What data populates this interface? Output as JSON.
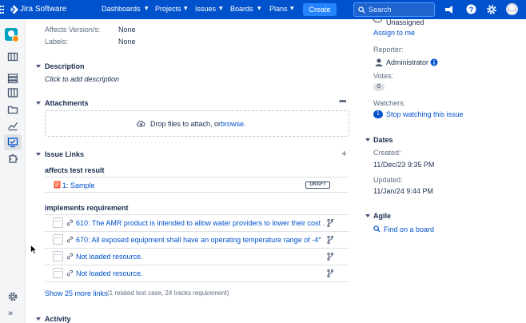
{
  "topnav": {
    "brand": "Jira Software",
    "menus": [
      "Dashboards",
      "Projects",
      "Issues",
      "Boards",
      "Plans"
    ],
    "create_label": "Create",
    "search_placeholder": "Search"
  },
  "fields": {
    "affects_versions_label": "Affects Version/s:",
    "affects_versions_value": "None",
    "labels_label": "Labels:",
    "labels_value": "None"
  },
  "description": {
    "title": "Description",
    "placeholder": "Click to add description"
  },
  "attachments": {
    "title": "Attachments",
    "drop_text": "Drop files to attach, or",
    "browse_link": "browse."
  },
  "issue_links": {
    "title": "Issue Links",
    "groups": [
      {
        "heading": "affects test result",
        "items": [
          {
            "text": "1: Sample",
            "badge": "DRAFT"
          }
        ]
      },
      {
        "heading": "implements requirement",
        "items": [
          {
            "text": "610: The AMR product is intended to allow water providers to lower their cost ..."
          },
          {
            "text": "670: All exposed equipment shall have an operating temperature range of -4° ..."
          },
          {
            "text": "Not loaded resource."
          },
          {
            "text": "Not loaded resource."
          }
        ]
      }
    ],
    "show_more_link": "Show 25 more links",
    "show_more_detail": "(1 related test case, 24 tracks requirement)"
  },
  "activity": {
    "title": "Activity"
  },
  "people": {
    "assignee_value": "Unassigned",
    "assign_to_me": "Assign to me",
    "reporter_label": "Reporter:",
    "reporter_value": "Administrator",
    "votes_label": "Votes:",
    "votes_count": "0",
    "watchers_label": "Watchers:",
    "watchers_count": "1",
    "stop_watching": "Stop watching this issue"
  },
  "dates": {
    "title": "Dates",
    "created_label": "Created:",
    "created_value": "11/Dec/23 9:35 PM",
    "updated_label": "Updated:",
    "updated_value": "11/Jan/24 9:44 PM"
  },
  "agile": {
    "title": "Agile",
    "find_on_board": "Find on a board"
  },
  "colors": {
    "nav_bg": "#0052cc",
    "link": "#0052cc",
    "create_bg": "#2684ff"
  }
}
